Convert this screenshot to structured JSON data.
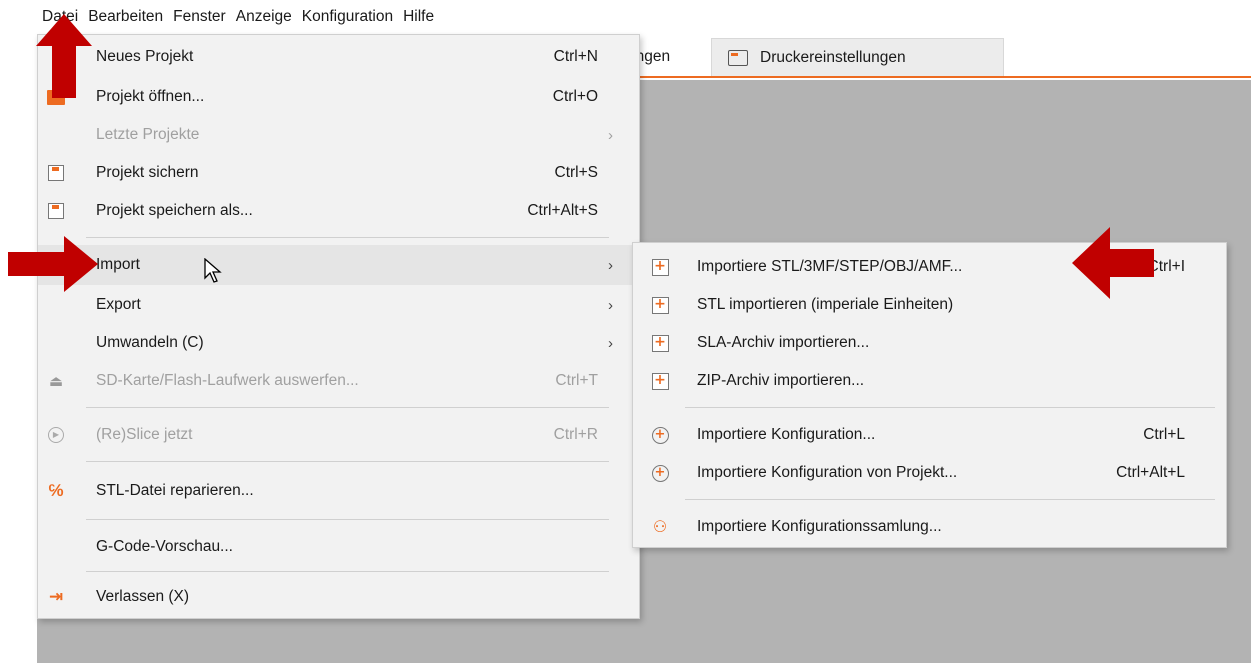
{
  "menubar": {
    "items": [
      "Datei",
      "Bearbeiten",
      "Fenster",
      "Anzeige",
      "Konfiguration",
      "Hilfe"
    ]
  },
  "tabs": {
    "partial_label": "ungen",
    "printer_label": "Druckereinstellungen"
  },
  "file_menu": {
    "items": [
      {
        "label": "Neues Projekt",
        "shortcut": "Ctrl+N",
        "icon": "none"
      },
      {
        "label": "Projekt öffnen...",
        "shortcut": "Ctrl+O",
        "icon": "folder-icon"
      },
      {
        "label": "Letzte Projekte",
        "shortcut": "",
        "icon": "none",
        "submenu": true,
        "disabled": true
      },
      {
        "label": "Projekt sichern",
        "shortcut": "Ctrl+S",
        "icon": "save-icon"
      },
      {
        "label": "Projekt speichern als...",
        "shortcut": "Ctrl+Alt+S",
        "icon": "save-as-icon"
      },
      {
        "label": "Import",
        "shortcut": "",
        "icon": "none",
        "submenu": true,
        "highlighted": true
      },
      {
        "label": "Export",
        "shortcut": "",
        "icon": "none",
        "submenu": true
      },
      {
        "label": "Umwandeln (C)",
        "shortcut": "",
        "icon": "none",
        "submenu": true
      },
      {
        "label": "SD-Karte/Flash-Laufwerk auswerfen...",
        "shortcut": "Ctrl+T",
        "icon": "eject-icon",
        "disabled": true
      },
      {
        "label": "(Re)Slice jetzt",
        "shortcut": "Ctrl+R",
        "icon": "play-icon",
        "disabled": true
      },
      {
        "label": "STL-Datei reparieren...",
        "shortcut": "",
        "icon": "repair-icon"
      },
      {
        "label": "G-Code-Vorschau...",
        "shortcut": "",
        "icon": "none"
      },
      {
        "label": "Verlassen (X)",
        "shortcut": "",
        "icon": "exit-icon"
      }
    ],
    "submenu_arrow": "›"
  },
  "import_submenu": {
    "items": [
      {
        "label": "Importiere STL/3MF/STEP/OBJ/AMF...",
        "shortcut": "Ctrl+I",
        "icon": "import-plus-icon"
      },
      {
        "label": "STL importieren (imperiale Einheiten)",
        "shortcut": "",
        "icon": "import-plus-icon"
      },
      {
        "label": "SLA-Archiv importieren...",
        "shortcut": "",
        "icon": "import-plus-icon"
      },
      {
        "label": "ZIP-Archiv importieren...",
        "shortcut": "",
        "icon": "import-plus-icon"
      },
      {
        "label": "Importiere Konfiguration...",
        "shortcut": "Ctrl+L",
        "icon": "config-import-icon"
      },
      {
        "label": "Importiere Konfiguration von Projekt...",
        "shortcut": "Ctrl+Alt+L",
        "icon": "config-import-icon"
      },
      {
        "label": "Importiere Konfigurationssamlung...",
        "shortcut": "",
        "icon": "config-bundle-icon"
      }
    ]
  },
  "colors": {
    "accent": "#ed6b21",
    "annotation_arrow": "#c00000",
    "canvas": "#b3b3b3",
    "menu_bg": "#f2f2f2"
  }
}
